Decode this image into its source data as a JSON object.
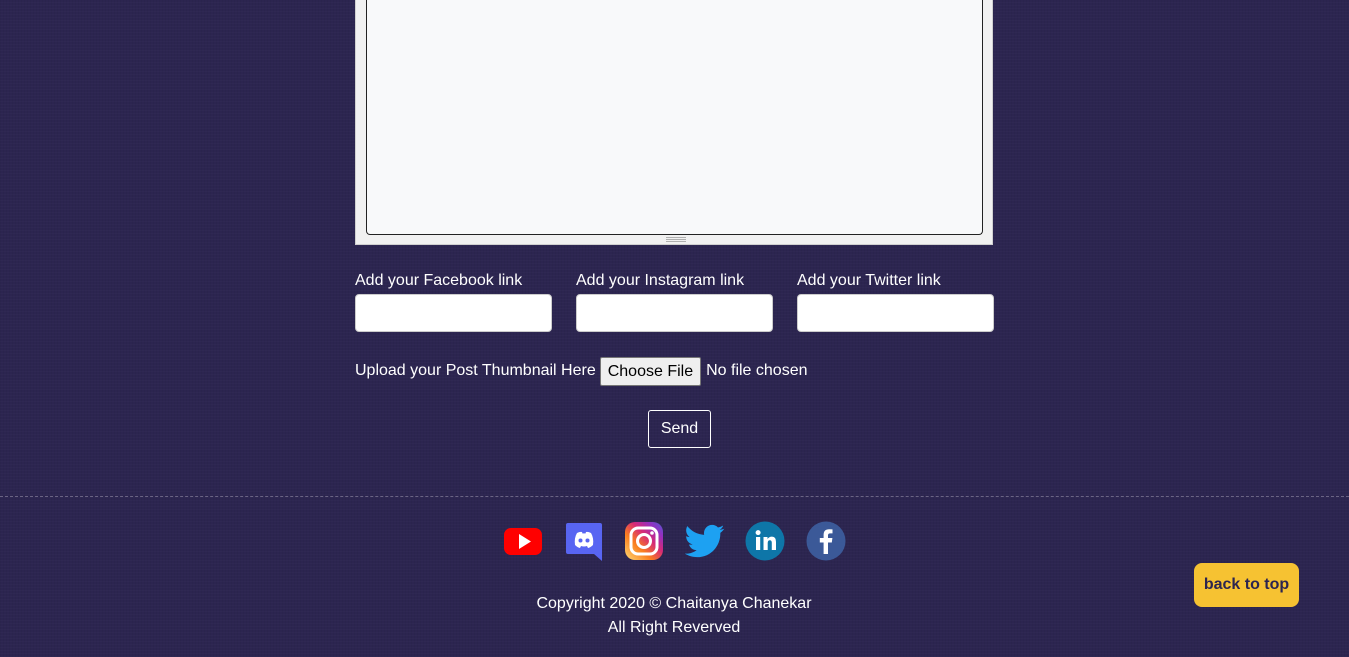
{
  "form": {
    "facebook_label": "Add your Facebook link",
    "instagram_label": "Add your Instagram link",
    "twitter_label": "Add your Twitter link",
    "facebook_value": "",
    "instagram_value": "",
    "twitter_value": "",
    "thumbnail_label": "Upload your Post Thumbnail Here",
    "choose_file_label": "Choose File",
    "file_status": "No file chosen",
    "send_label": "Send"
  },
  "footer": {
    "social_icons": [
      "youtube-icon",
      "discord-icon",
      "instagram-icon",
      "twitter-icon",
      "linkedin-icon",
      "facebook-icon"
    ],
    "copyright_line1": "Copyright 2020 © Chaitanya Chanekar",
    "copyright_line2": "All Right Reverved",
    "back_to_top_label": "back to top"
  },
  "colors": {
    "background": "#2c2550",
    "accent_button": "#f6c232",
    "text": "#ffffff"
  }
}
